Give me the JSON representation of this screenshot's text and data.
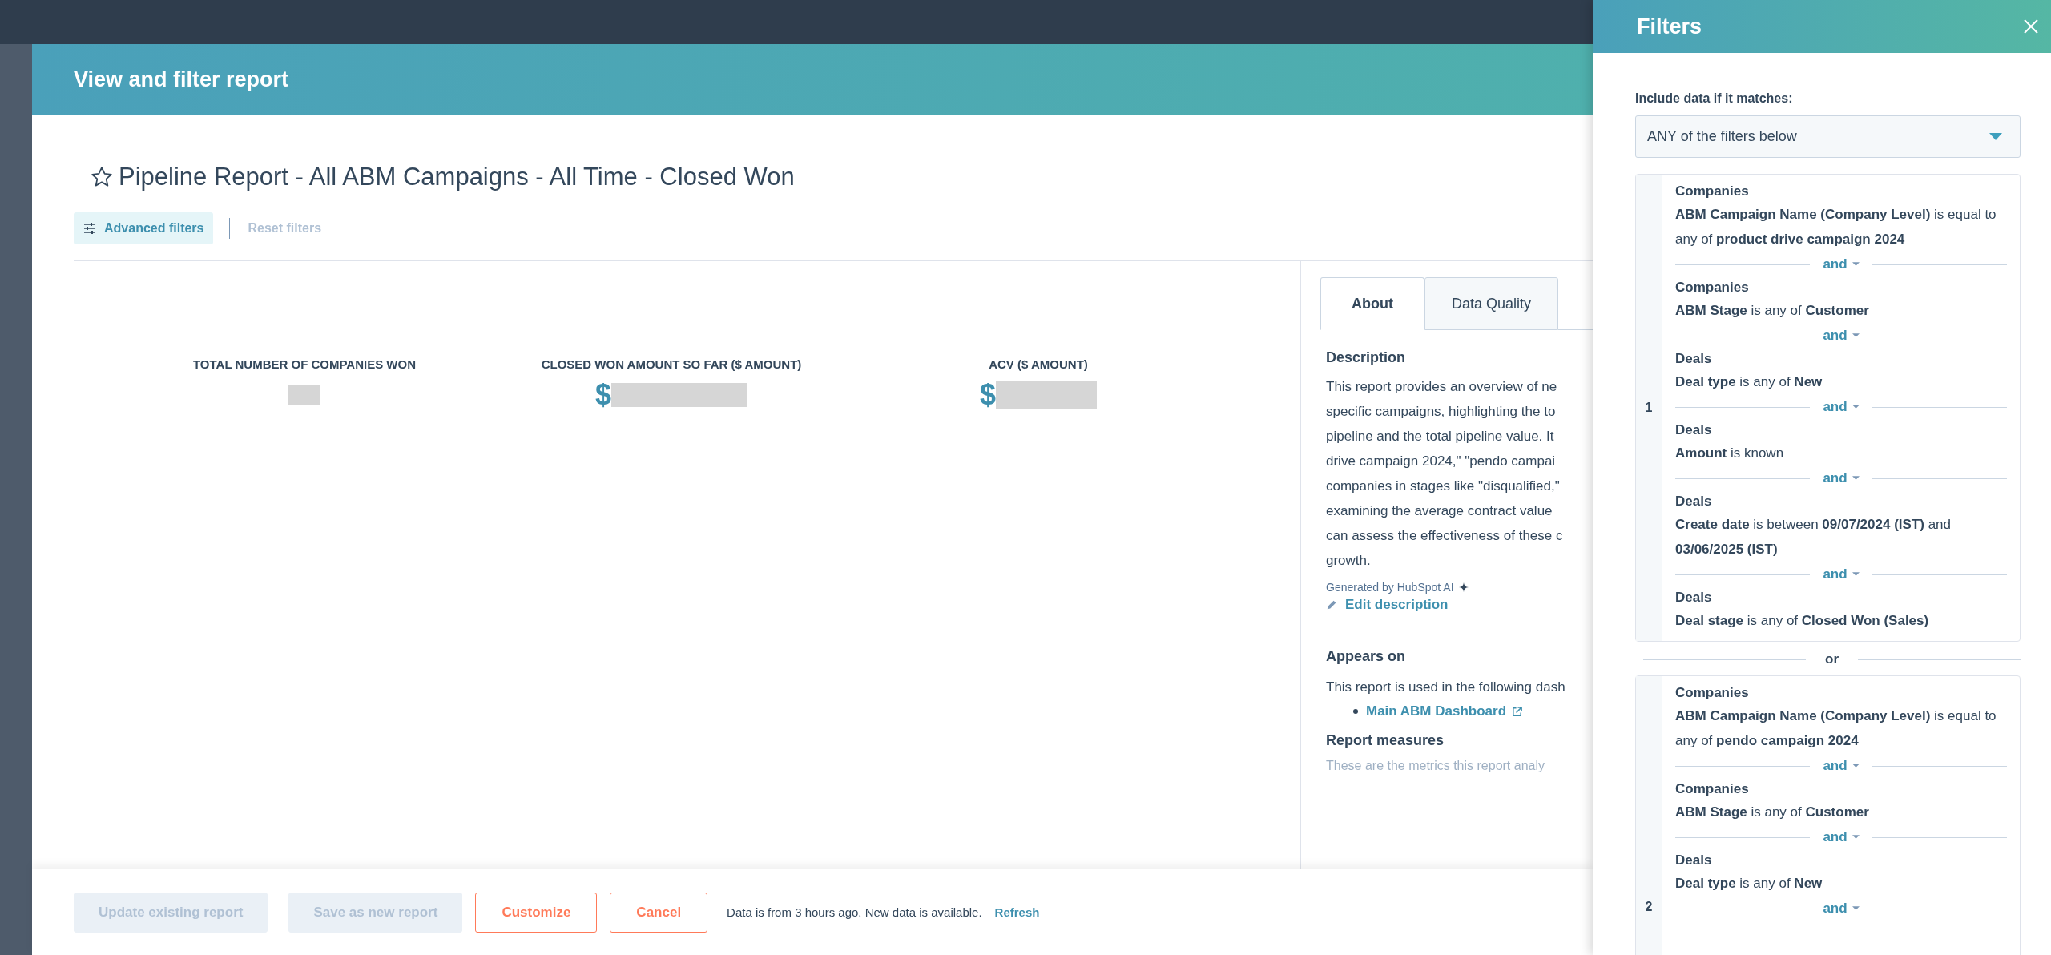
{
  "modal": {
    "title": "View and filter report",
    "report_title": "Pipeline Report - All ABM Campaigns - All Time - Closed Won",
    "starred": false,
    "toolbar": [
      {
        "label": "Advanced filters",
        "kind": "filters",
        "disabled": false
      },
      {
        "label": "Reset filters",
        "kind": "reset",
        "disabled": true
      }
    ],
    "kpis": [
      {
        "label": "TOTAL NUMBER OF COMPANIES WON",
        "redacted": true
      },
      {
        "label": "CLOSED WON AMOUNT SO FAR ($ AMOUNT)",
        "value": "$",
        "redacted": true
      },
      {
        "label": "ACV ($ AMOUNT)",
        "value": "$",
        "redacted": true
      }
    ],
    "tabs": [
      {
        "label": "About",
        "selected": true
      },
      {
        "label": "Data Quality",
        "selected": false
      }
    ],
    "about": {
      "description_heading": "Description",
      "description_lines": [
        "This report provides an overview of ne",
        "specific campaigns, highlighting the to",
        "pipeline and the total pipeline value. It",
        "drive campaign 2024,\" \"pendo campai",
        "companies in stages like \"disqualified,\"",
        "examining the average contract value",
        "can assess the effectiveness of these c",
        "growth."
      ],
      "ai_note": "Generated by HubSpot AI",
      "edit_link": "Edit description",
      "appears_heading": "Appears on",
      "appears_text": "This report is used in the following dash",
      "dashboards": [
        "Main ABM Dashboard"
      ],
      "measures_heading": "Report measures",
      "measures_text": "These are the metrics this report analy"
    },
    "footer": {
      "buttons": [
        {
          "label": "Update existing report",
          "kind": "primary",
          "disabled": true
        },
        {
          "label": "Save as new report",
          "kind": "secondary",
          "disabled": true
        },
        {
          "label": "Customize",
          "kind": "outline",
          "disabled": false
        },
        {
          "label": "Cancel",
          "kind": "outline",
          "disabled": false
        }
      ],
      "status": "Data is from 3 hours ago. New data is available.",
      "refresh": "Refresh"
    }
  },
  "filters": {
    "title": "Filters",
    "match_label": "Include data if it matches:",
    "match_value": "ANY of the filters below",
    "group_joiner": "or",
    "groups": [
      {
        "number": "1",
        "conditions": [
          {
            "object": "Companies",
            "rule": "**ABM Campaign Name (Company Level)** is equal to any of **product drive campaign 2024**"
          },
          {
            "joiner": "and",
            "object": "Companies",
            "rule": "**ABM Stage** is any of **Customer**"
          },
          {
            "joiner": "and",
            "object": "Deals",
            "rule": "**Deal type** is any of **New**"
          },
          {
            "joiner": "and",
            "object": "Deals",
            "rule": "**Amount** is known"
          },
          {
            "joiner": "and",
            "object": "Deals",
            "rule": "**Create date** is between **09/07/2024 (IST)** and **03/06/2025 (IST)**"
          },
          {
            "joiner": "and",
            "object": "Deals",
            "rule": "**Deal stage** is any of **Closed Won (Sales)**"
          }
        ]
      },
      {
        "number": "2",
        "conditions": [
          {
            "object": "Companies",
            "rule": "**ABM Campaign Name (Company Level)** is equal to any of **pendo campaign 2024**"
          },
          {
            "joiner": "and",
            "object": "Companies",
            "rule": "**ABM Stage** is any of **Customer**"
          },
          {
            "joiner": "and",
            "object": "Deals",
            "rule": "**Deal type** is any of **New**"
          },
          {
            "joiner": "and"
          }
        ]
      }
    ]
  }
}
